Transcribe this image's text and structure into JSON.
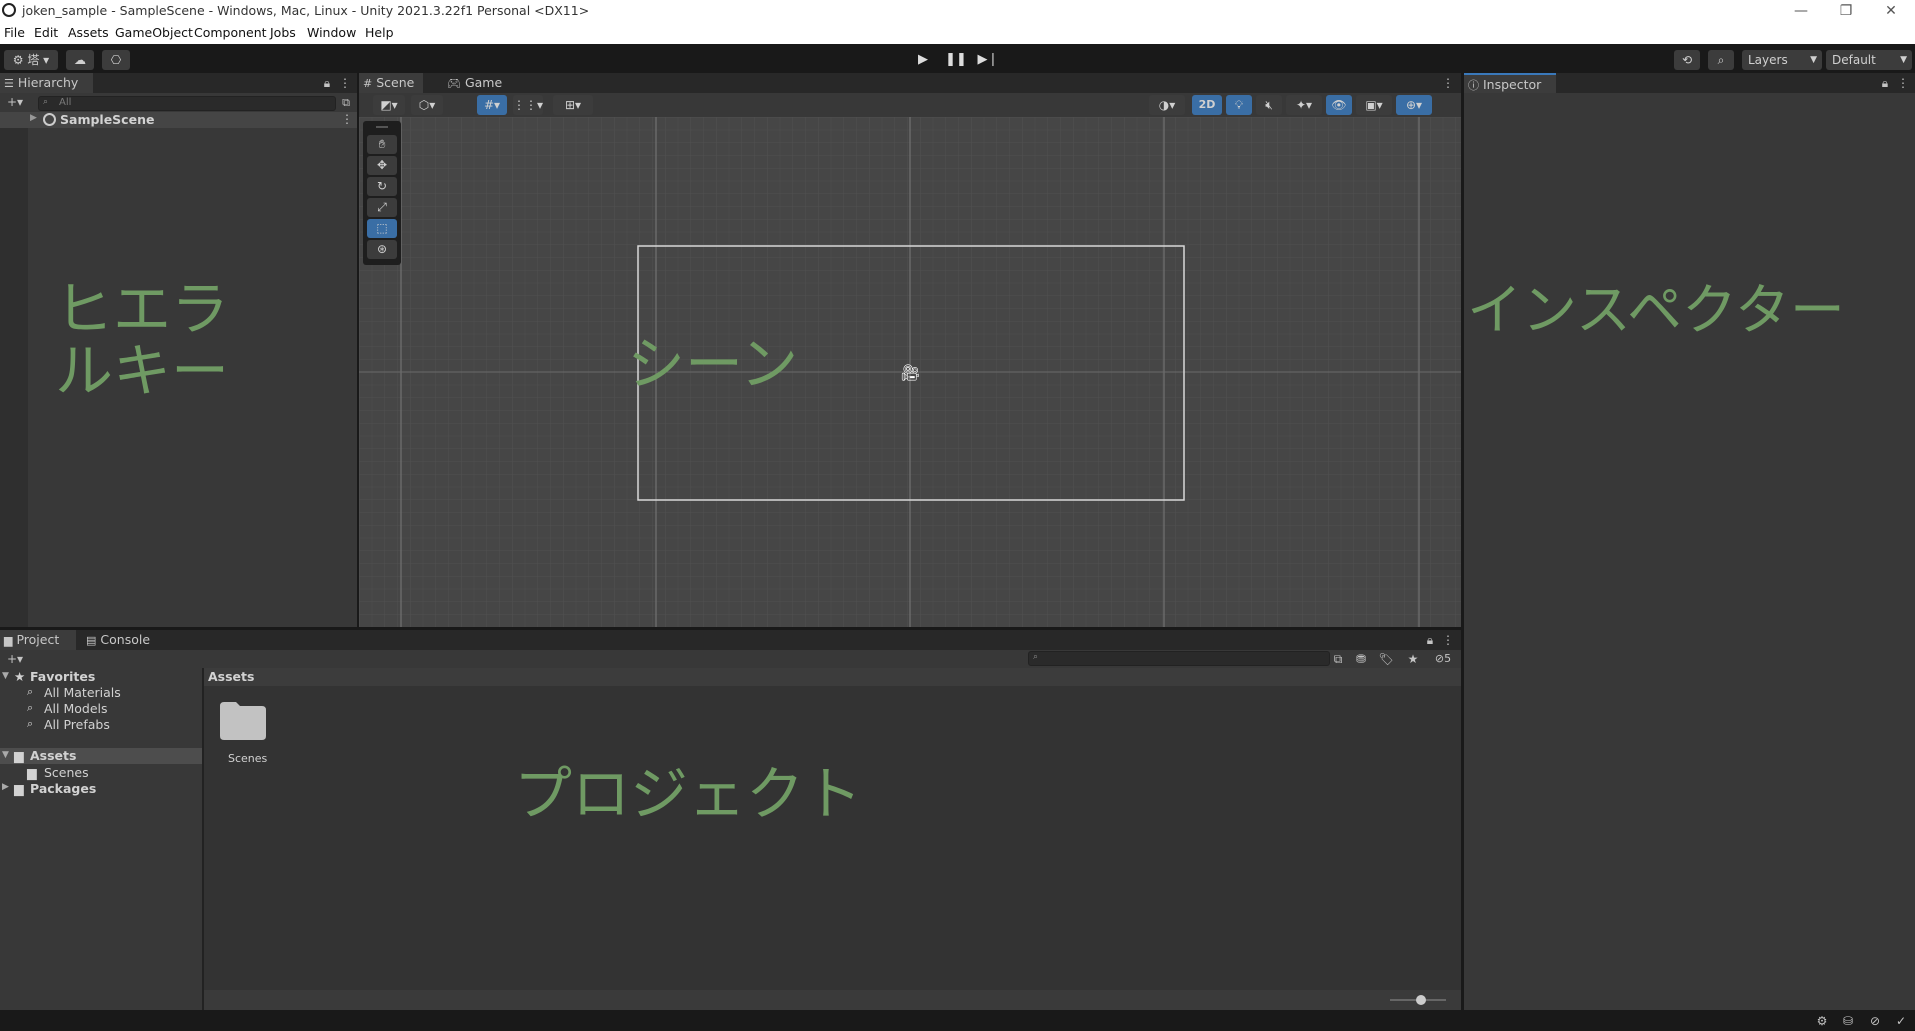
{
  "window": {
    "title": "joken_sample - SampleScene - Windows, Mac, Linux - Unity 2021.3.22f1 Personal <DX11>",
    "controls": [
      "—",
      "❐",
      "✕"
    ]
  },
  "menu": [
    "File",
    "Edit",
    "Assets",
    "GameObject",
    "Component",
    "Jobs",
    "Window",
    "Help"
  ],
  "toolbar": {
    "account_label": "⚙ 塔 ▾",
    "layers_label": "Layers",
    "layout_label": "Default",
    "icons": [
      "account-icon",
      "cloud-icon",
      "collab-icon",
      "play-icon",
      "pause-icon",
      "step-icon",
      "history-icon",
      "search-icon"
    ]
  },
  "hierarchy": {
    "tab_label": "Hierarchy",
    "search_placeholder": "All",
    "scene_name": "SampleScene",
    "overlay_label_line1": "ヒエラ",
    "overlay_label_line2": "ルキー"
  },
  "scene_view": {
    "tabs": [
      "Scene",
      "Game"
    ],
    "mode_2d_label": "2D",
    "overlay_label": "シーン",
    "tools": [
      "hand-tool",
      "move-tool",
      "rotate-tool",
      "scale-tool",
      "rect-tool",
      "transform-tool"
    ],
    "active_tool": "rect-tool"
  },
  "inspector": {
    "tab_label": "Inspector",
    "overlay_label": "インスペクター"
  },
  "project": {
    "tabs": [
      "Project",
      "Console"
    ],
    "favorites_label": "Favorites",
    "favorites": [
      "All Materials",
      "All Models",
      "All Prefabs"
    ],
    "assets_label": "Assets",
    "assets_children": [
      "Scenes"
    ],
    "packages_label": "Packages",
    "breadcrumb": "Assets",
    "items": [
      {
        "name": "Scenes",
        "type": "folder"
      }
    ],
    "hidden_count": "5",
    "overlay_label": "プロジェクト"
  },
  "colors": {
    "accent_blue": "#3a6ea5",
    "label_green": "#6f9a63",
    "panel_bg": "#383838",
    "toolbar_bg": "#191919"
  }
}
